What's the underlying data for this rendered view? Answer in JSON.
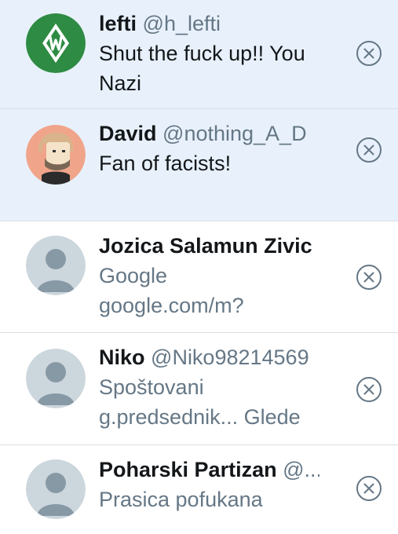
{
  "notifications": [
    {
      "name": "lefti",
      "handle": "@h_lefti",
      "lines": [
        "Shut the fuck up!! You",
        "Nazi"
      ],
      "unread": true,
      "avatar": "werder-bremen-logo"
    },
    {
      "name": "David",
      "handle": "@nothing_A_D",
      "lines": [
        "Fan of facists!"
      ],
      "unread": true,
      "avatar": "cartoon-portrait"
    },
    {
      "name": "Jozica Salamun Zivic",
      "handle": "@",
      "lines": [
        "Google",
        "google.com/m?"
      ],
      "unread": false,
      "avatar": "default-profile"
    },
    {
      "name": "Niko",
      "handle": "@Niko98214569",
      "lines": [
        "Spoštovani",
        "g.predsednik... Glede"
      ],
      "unread": false,
      "avatar": "default-profile"
    },
    {
      "name": "Poharski Partizan",
      "handle": "@...",
      "lines": [
        "Prasica pofukana"
      ],
      "unread": false,
      "avatar": "default-profile"
    }
  ],
  "colors": {
    "unread_background": "#e8f1fb",
    "name_text": "#14171a",
    "secondary_text": "#657786",
    "divider": "#d9dee3",
    "default_avatar_bg": "#ccd6dd",
    "default_avatar_fg": "#8899a6",
    "bremen_green": "#2e8b44"
  },
  "icons": {
    "dismiss": "close-circle-icon"
  }
}
